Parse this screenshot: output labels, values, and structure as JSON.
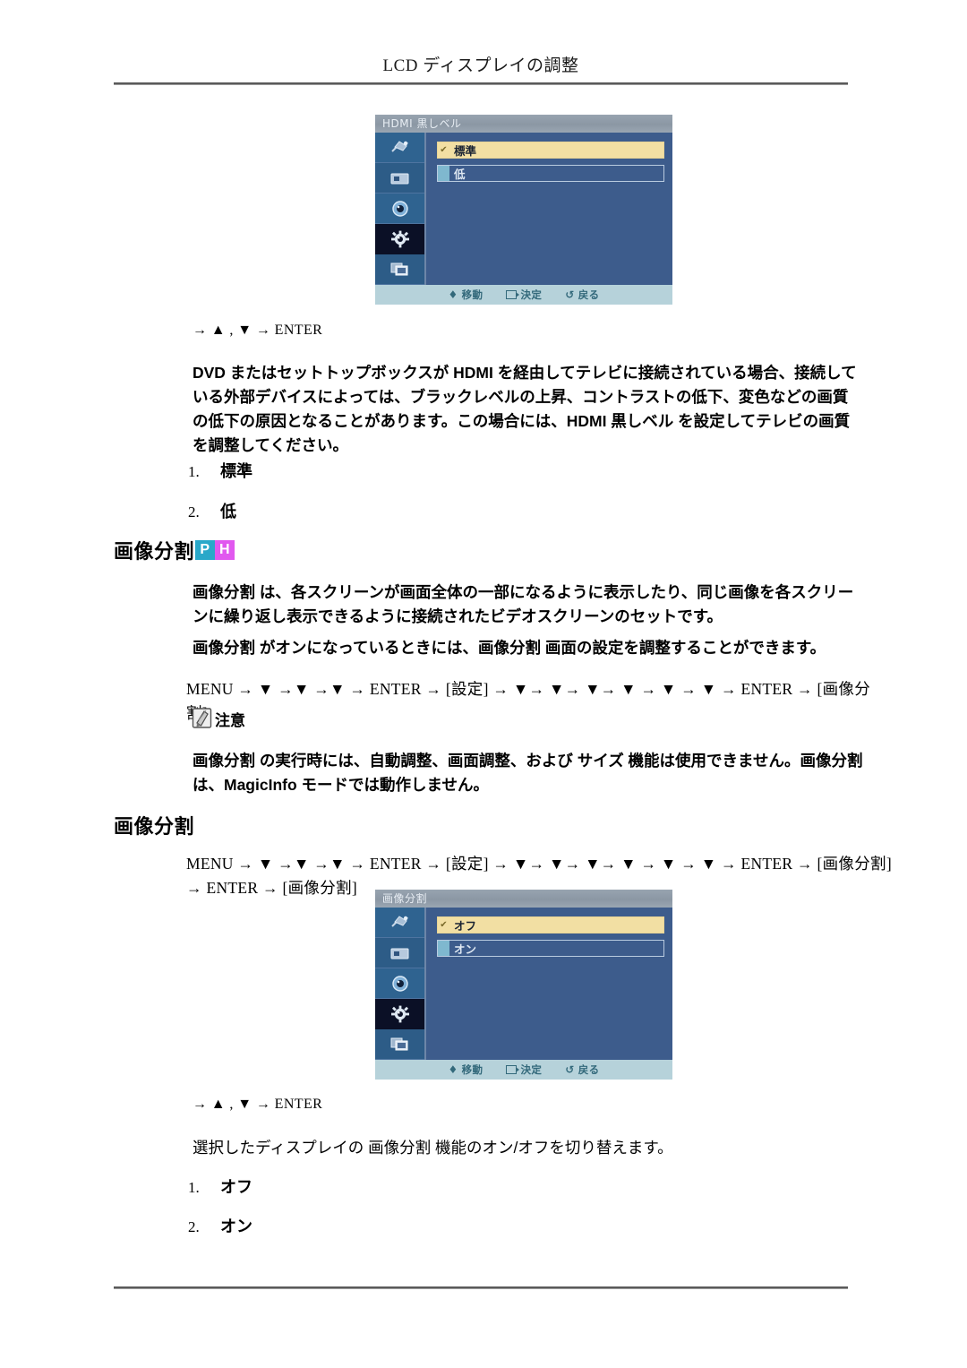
{
  "page": {
    "header_title": "LCD ディスプレイの調整"
  },
  "osd_hdmi": {
    "title": "HDMI 黒しベル",
    "options": [
      {
        "label": "標準",
        "selected": true
      },
      {
        "label": "低",
        "selected": false
      }
    ],
    "footer": {
      "move": "移動",
      "enter": "決定",
      "return": "戻る"
    },
    "sidebar_icons": [
      "picture-icon",
      "display-icon",
      "sound-icon",
      "setup-icon",
      "multi-display-icon"
    ],
    "colors": {
      "title_bar": "#8e9aa6",
      "body": "#3d5c8c",
      "selected_row": "#f2dfa3",
      "footer": "#b6d2da",
      "footer_text": "#33697b"
    }
  },
  "section_hdmi": {
    "keys_line": "→ ▲ , ▼ → ENTER",
    "paragraph": "DVD またはセットトップボックスが HDMI を経由してテレビに接続されている場合、接続している外部デバイスによっては、ブラックレベルの上昇、コントラストの低下、変色などの画質の低下の原因となることがあります。この場合には、HDMI 黒しベル を設定してテレビの画質を調整してください。",
    "items": [
      {
        "num": "1.",
        "value": "標準"
      },
      {
        "num": "2.",
        "value": "低"
      }
    ]
  },
  "section_pip": {
    "title": "画像分割",
    "badges": [
      {
        "letter": "P",
        "color": "#29a8c9"
      },
      {
        "letter": "H",
        "color": "#e158ef"
      }
    ],
    "paragraph1": "画像分割 は、各スクリーンが画面全体の一部になるように表示したり、同じ画像を各スクリーンに繰り返し表示できるように接続されたビデオスクリーンのセットです。",
    "paragraph2": "画像分割 がオンになっているときには、画像分割 画面の設定を調整することができます。",
    "menu_path": "MENU → ▼ →▼ →▼ → ENTER → [設定] → ▼→ ▼→ ▼→ ▼ → ▼ → ▼ → ENTER → [画像分割]",
    "note_label": "注意",
    "note_icon": "note-pen-icon",
    "note_text": "画像分割 の実行時には、自動調整、画面調整、および サイズ 機能は使用できません。画像分割 は、MagicInfo モードでは動作しません。"
  },
  "section_pip2": {
    "title": "画像分割",
    "menu_path_line1": "MENU → ▼ →▼ →▼ → ENTER → [設定] → ▼→ ▼→ ▼→ ▼ → ▼ → ▼ → ENTER → [画像分割]",
    "menu_path_line2": "→ ENTER → [画像分割]",
    "keys_line": "→ ▲ , ▼ → ENTER",
    "description": "選択したディスプレイの 画像分割 機能のオン/オフを切り替えます。",
    "items": [
      {
        "num": "1.",
        "value": "オフ"
      },
      {
        "num": "2.",
        "value": "オン"
      }
    ]
  },
  "osd_pip": {
    "title": "画像分割",
    "options": [
      {
        "label": "オフ",
        "selected": true
      },
      {
        "label": "オン",
        "selected": false
      }
    ],
    "footer": {
      "move": "移動",
      "enter": "決定",
      "return": "戻る"
    },
    "sidebar_icons": [
      "picture-icon",
      "display-icon",
      "sound-icon",
      "setup-icon",
      "multi-display-icon"
    ]
  }
}
